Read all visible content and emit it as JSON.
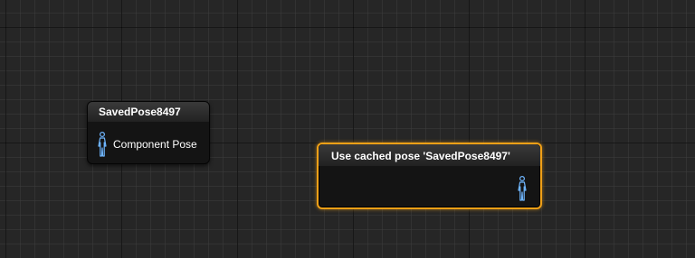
{
  "nodes": {
    "saved_pose": {
      "title": "SavedPose8497",
      "pin_label": "Component Pose",
      "pin_icon": "pose-figure-icon"
    },
    "use_cached_pose": {
      "title": "Use cached pose 'SavedPose8497'",
      "pin_icon": "pose-figure-icon",
      "selected": true
    }
  },
  "colors": {
    "canvas": "#262626",
    "node_body": "#141414",
    "selection_outline": "#f0a017",
    "pose_pin": "#6fb6ff"
  }
}
